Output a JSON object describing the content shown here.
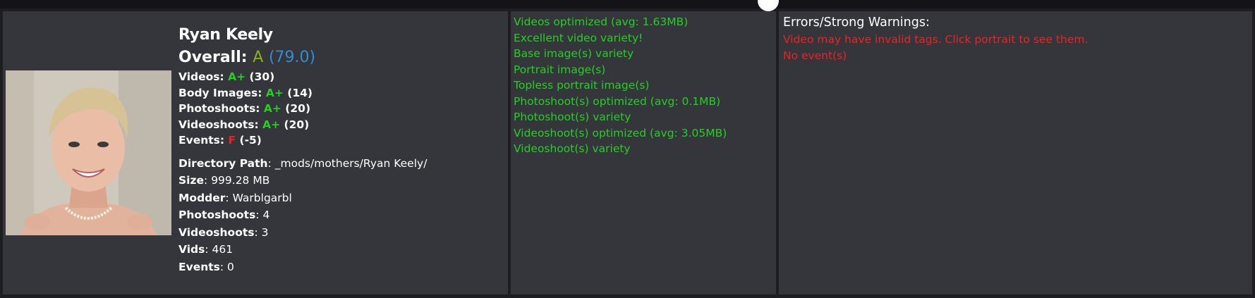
{
  "profile": {
    "name": "Ryan Keely",
    "overall_label": "Overall:",
    "overall_grade": "A",
    "overall_score": "(79.0)",
    "stats": [
      {
        "label": "Videos",
        "grade": "A+",
        "count": "(30)"
      },
      {
        "label": "Body Images",
        "grade": "A+",
        "count": "(14)"
      },
      {
        "label": "Photoshoots",
        "grade": "A+",
        "count": "(20)"
      },
      {
        "label": "Videoshoots",
        "grade": "A+",
        "count": "(20)"
      },
      {
        "label": "Events",
        "grade": "F",
        "count": "(-5)"
      }
    ],
    "meta": [
      {
        "label": "Directory Path",
        "value": "_mods/mothers/Ryan Keely/"
      },
      {
        "label": "Size",
        "value": "999.28 MB"
      },
      {
        "label": "Modder",
        "value": "Warblgarbl"
      },
      {
        "label": "Photoshoots",
        "value": "4"
      },
      {
        "label": "Videoshoots",
        "value": "3"
      },
      {
        "label": "Vids",
        "value": "461"
      },
      {
        "label": "Events",
        "value": "0"
      }
    ],
    "colon": ":"
  },
  "checks": {
    "ok": [
      "Videos optimized (avg: 1.63MB)",
      "Excellent video variety!",
      "Base image(s) variety",
      "Portrait image(s)",
      "Topless portrait image(s)",
      "Photoshoot(s) optimized (avg: 0.1MB)",
      "Photoshoot(s) variety",
      "Videoshoot(s) optimized (avg: 3.05MB)",
      "Videoshoot(s) variety"
    ]
  },
  "errors": {
    "title": "Errors/Strong Warnings:",
    "items": [
      "Video may have invalid tags. Click portrait to see them.",
      "No event(s)"
    ]
  },
  "colors": {
    "ok_green": "#22d122",
    "error_red": "#ee2222",
    "grade_a": "#8ab11d",
    "score_blue": "#2f8fd0",
    "panel_bg": "#35353c"
  }
}
